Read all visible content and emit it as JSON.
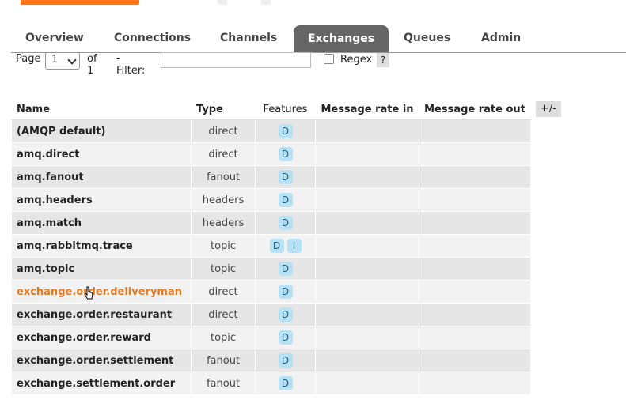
{
  "tabs": [
    "Overview",
    "Connections",
    "Channels",
    "Exchanges",
    "Queues",
    "Admin"
  ],
  "filter": {
    "page_label": "Page",
    "page_value": "1",
    "of_label": "of 1",
    "filter_label": "- Filter:",
    "filter_value": "",
    "regex_label": "Regex",
    "help_label": "?"
  },
  "table": {
    "headers": [
      "Name",
      "Type",
      "Features",
      "Message rate in",
      "Message rate out"
    ],
    "toggle_label": "+/-",
    "rows": [
      {
        "name": "(AMQP default)",
        "type": "direct",
        "features": [
          "D"
        ]
      },
      {
        "name": "amq.direct",
        "type": "direct",
        "features": [
          "D"
        ]
      },
      {
        "name": "amq.fanout",
        "type": "fanout",
        "features": [
          "D"
        ]
      },
      {
        "name": "amq.headers",
        "type": "headers",
        "features": [
          "D"
        ]
      },
      {
        "name": "amq.match",
        "type": "headers",
        "features": [
          "D"
        ]
      },
      {
        "name": "amq.rabbitmq.trace",
        "type": "topic",
        "features": [
          "D",
          "I"
        ]
      },
      {
        "name": "amq.topic",
        "type": "topic",
        "features": [
          "D"
        ]
      },
      {
        "name": "exchange.order.deliveryman",
        "type": "direct",
        "features": [
          "D"
        ]
      },
      {
        "name": "exchange.order.restaurant",
        "type": "direct",
        "features": [
          "D"
        ]
      },
      {
        "name": "exchange.order.reward",
        "type": "topic",
        "features": [
          "D"
        ]
      },
      {
        "name": "exchange.order.settlement",
        "type": "fanout",
        "features": [
          "D"
        ]
      },
      {
        "name": "exchange.settlement.order",
        "type": "fanout",
        "features": [
          "D"
        ]
      }
    ]
  },
  "colors": {
    "active_tab": "#666666",
    "link_hover": "#e5791e",
    "badge_bg": "#b7e2f6",
    "row_odd": "#f2f2f2",
    "row_even": "#e6e6e6"
  }
}
